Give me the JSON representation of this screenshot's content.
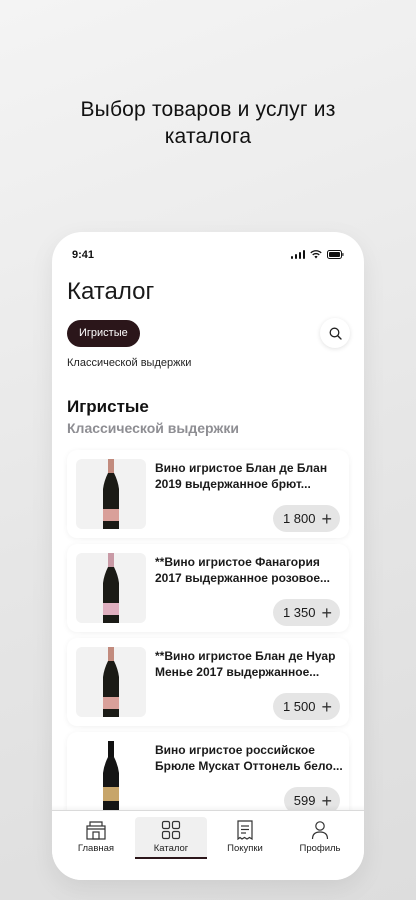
{
  "headline": {
    "line1": "Выбор товаров и услуг из",
    "line2": "каталога"
  },
  "status_bar": {
    "time": "9:41"
  },
  "header": {
    "title": "Каталог"
  },
  "filters": {
    "chip": "Игристые",
    "subcategory": "Классической выдержки"
  },
  "section": {
    "title": "Игристые",
    "subtitle": "Классической выдержки"
  },
  "products": [
    {
      "name": "Вино игристое Блан де Блан 2019 выдержанное брют...",
      "price": "1 800",
      "label_color": "#d9a09a"
    },
    {
      "name": "**Вино игристое Фанагория 2017 выдержанное розовое...",
      "price": "1 350",
      "label_color": "#e0b0c0"
    },
    {
      "name": "**Вино игристое Блан де Нуар Менье 2017 выдержанное...",
      "price": "1 500",
      "label_color": "#d9a09a"
    },
    {
      "name": "Вино игристое российское Брюле Мускат Оттонель бело...",
      "price": "599",
      "label_color": "#c7a56a"
    }
  ],
  "tabs": [
    {
      "label": "Главная",
      "icon": "home-icon"
    },
    {
      "label": "Каталог",
      "icon": "grid-icon",
      "active": true
    },
    {
      "label": "Покупки",
      "icon": "receipt-icon"
    },
    {
      "label": "Профиль",
      "icon": "person-icon"
    }
  ],
  "colors": {
    "accent": "#2b161a",
    "price_bg": "#e5e5e5",
    "muted": "#8e8e93"
  }
}
